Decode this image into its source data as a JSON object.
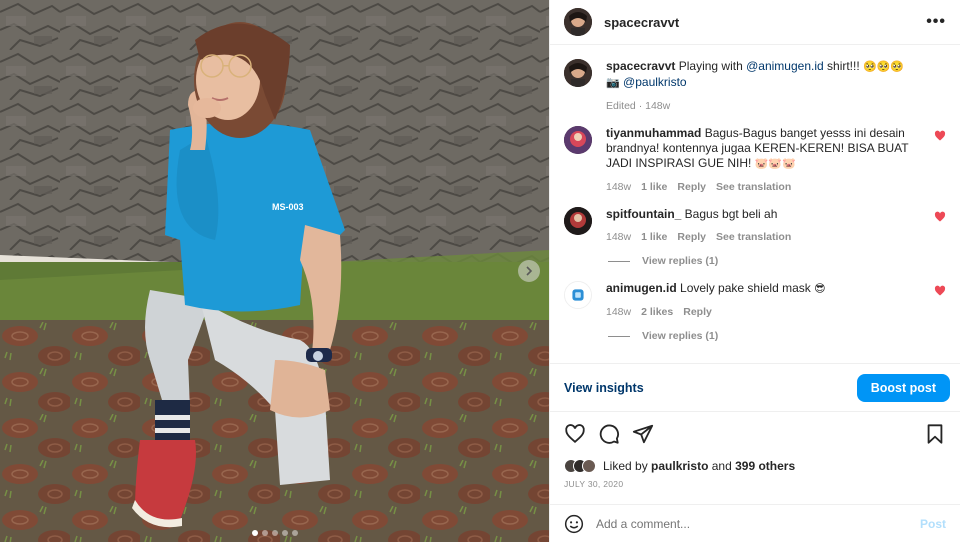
{
  "header": {
    "username": "spacecravvt"
  },
  "caption": {
    "username": "spacecravvt",
    "text_a": "Playing with",
    "mention_a": "@animugen.id",
    "text_b": "shirt!!!",
    "emojis_a": "🥺🥺🥺",
    "camera": "📷",
    "mention_b": "@paulkristo",
    "meta": "Edited · 148w"
  },
  "comments": [
    {
      "username": "tiyanmuhammad",
      "text": "Bagus-Bagus banget yesss ini desain brandnya! kontennya jugaa KEREN-KEREN! BISA BUAT JADI INSPIRASI GUE NIH!",
      "emoji": "🐷🐷🐷",
      "time": "148w",
      "likes": "1 like",
      "reply": "Reply",
      "translate": "See translation"
    },
    {
      "username": "spitfountain_",
      "text": "Bagus bgt beli ah",
      "emoji": "",
      "time": "148w",
      "likes": "1 like",
      "reply": "Reply",
      "translate": "See translation",
      "view_replies": "View replies (1)"
    },
    {
      "username": "animugen.id",
      "text": "Lovely pake shield mask",
      "emoji": "😎",
      "time": "148w",
      "likes": "2 likes",
      "reply": "Reply",
      "view_replies": "View replies (1)"
    }
  ],
  "insights": {
    "link": "View insights",
    "boost": "Boost post"
  },
  "likes": {
    "prefix": "Liked by",
    "user": "paulkristo",
    "and": "and",
    "others": "399 others"
  },
  "date": "JULY 30, 2020",
  "add_comment": {
    "placeholder": "Add a comment...",
    "post": "Post"
  },
  "carousel": {
    "count": 5,
    "active": 0
  },
  "colors": {
    "accent": "#0095f6",
    "heart": "#ed4956",
    "link": "#00376b",
    "shirt": "#1e9ad6"
  }
}
